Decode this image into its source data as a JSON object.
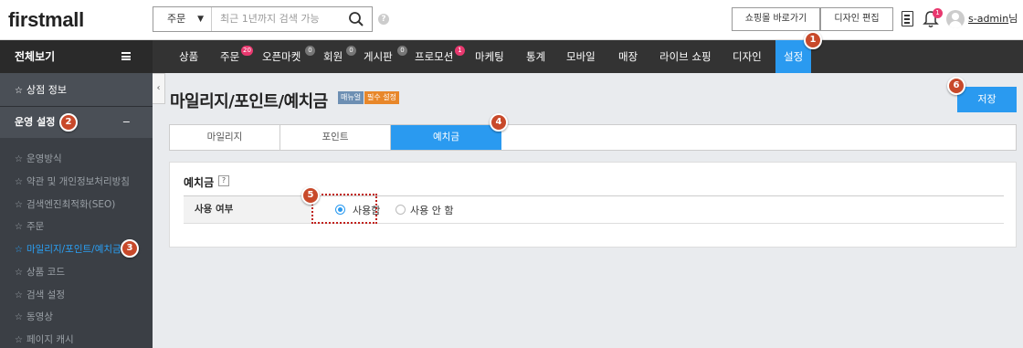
{
  "header": {
    "logo": "firstmall",
    "search": {
      "category": "주문",
      "placeholder": "최근 1년까지 검색 가능"
    },
    "help": "?",
    "buttons": {
      "shop": "쇼핑몰 바로가기",
      "design": "디자인 편집"
    },
    "bell_badge": "1",
    "username": "s-admin",
    "username_suffix": "님"
  },
  "nav": {
    "all_view": "전체보기",
    "items": [
      {
        "label": "상품"
      },
      {
        "label": "주문",
        "badge": "20"
      },
      {
        "label": "오픈마켓",
        "badge": "0"
      },
      {
        "label": "회원",
        "badge": "0"
      },
      {
        "label": "게시판",
        "badge": "0"
      },
      {
        "label": "프로모션",
        "badge": "1"
      },
      {
        "label": "마케팅"
      },
      {
        "label": "통계"
      },
      {
        "label": "모바일"
      },
      {
        "label": "매장"
      },
      {
        "label": "라이브 쇼핑"
      },
      {
        "label": "디자인"
      },
      {
        "label": "설정"
      }
    ]
  },
  "sidebar": {
    "store": "상점 정보",
    "section": "운영 설정",
    "section_toggle": "−",
    "items": [
      "운영방식",
      "약관 및 개인정보처리방침",
      "검색엔진최적화(SEO)",
      "주문",
      "마일리지/포인트/예치금",
      "상품 코드",
      "검색 설정",
      "동영상",
      "페이지 캐시"
    ]
  },
  "page": {
    "title": "마일리지/포인트/예치금",
    "tag_manual": "매뉴얼",
    "tag_required": "필수 설정",
    "save": "저장",
    "tabs": [
      "마일리지",
      "포인트",
      "예치금"
    ],
    "panel_title": "예치금",
    "panel_help": "?",
    "row_label": "사용 여부",
    "option_on": "사용함",
    "option_off": "사용 안 함"
  },
  "markers": [
    "1",
    "2",
    "3",
    "4",
    "5",
    "6"
  ],
  "colors": {
    "accent": "#2a9af0",
    "marker": "#c8492a",
    "badge_red": "#e8396f"
  }
}
